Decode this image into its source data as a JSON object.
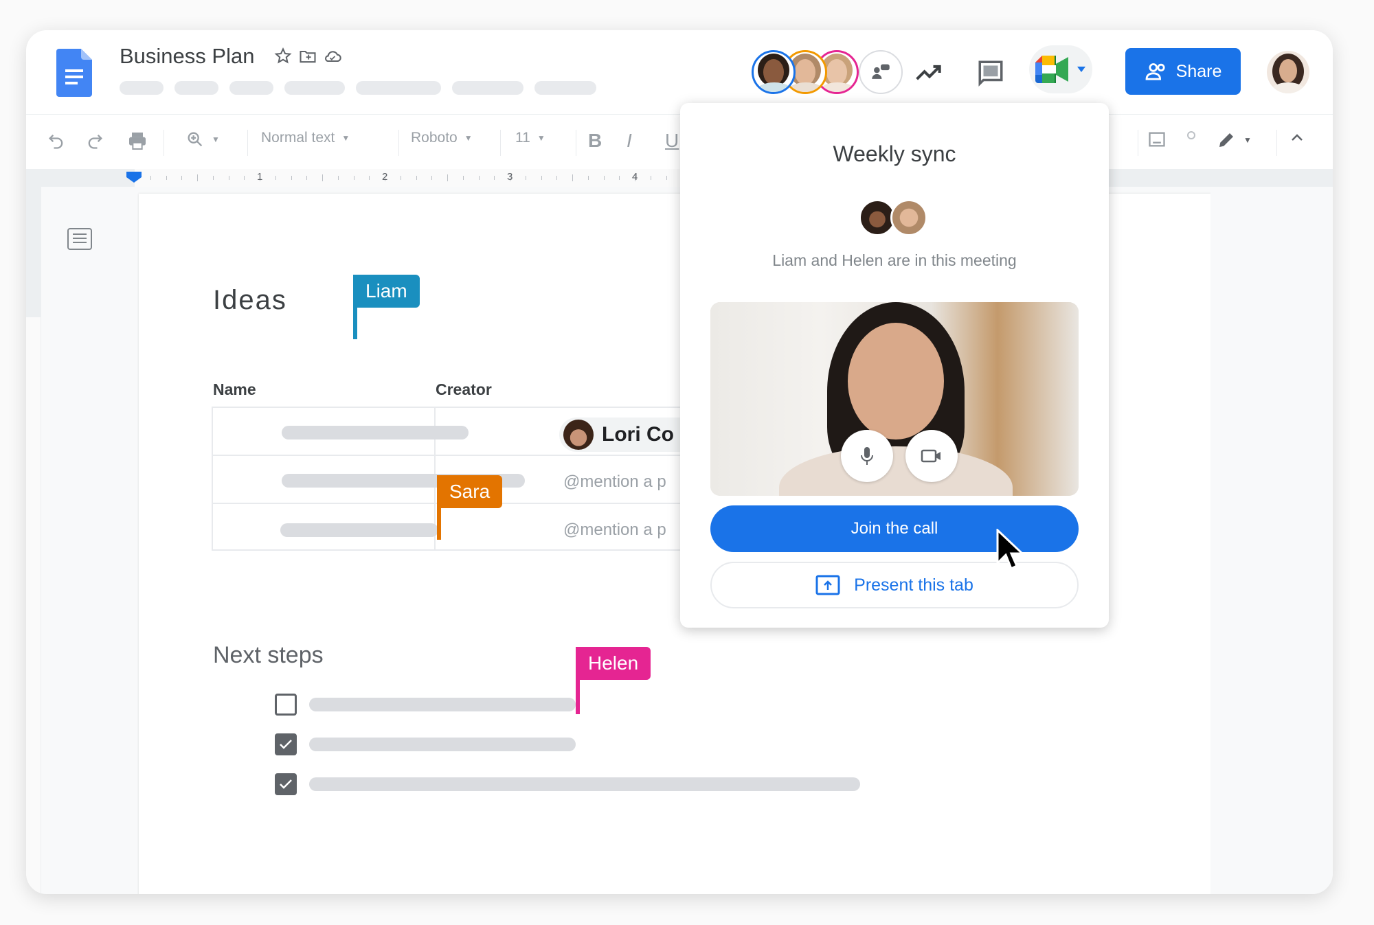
{
  "app": {
    "doc_title": "Business Plan",
    "title_icons": [
      "star-icon",
      "move-to-folder-icon",
      "cloud-saved-icon"
    ],
    "menu_placeholders": 7
  },
  "header": {
    "collaborators": [
      {
        "name": "collaborator-1",
        "ring_color": "#1a73e8"
      },
      {
        "name": "collaborator-2",
        "ring_color": "#f29900"
      },
      {
        "name": "collaborator-3",
        "ring_color": "#e52592"
      }
    ],
    "icons": [
      "people-chat-icon",
      "activity-trend-icon",
      "comments-icon",
      "google-meet-icon"
    ],
    "share_label": "Share",
    "share_color": "#1a73e8"
  },
  "toolbar": {
    "style": "Normal text",
    "font": "Roboto",
    "size": "11",
    "bold": "B",
    "italic": "I",
    "underline": "U"
  },
  "ruler": {
    "numbers": [
      "1",
      "2",
      "3",
      "4"
    ]
  },
  "document": {
    "heading_ideas": "Ideas",
    "table_headers": [
      "Name",
      "Creator"
    ],
    "creator_chip": "Lori Co",
    "mention_placeholder": "@mention a p",
    "heading_next": "Next steps",
    "checklist": [
      {
        "checked": false
      },
      {
        "checked": true
      },
      {
        "checked": true
      }
    ]
  },
  "cursors": [
    {
      "name": "Liam",
      "color": "#1a8fbf"
    },
    {
      "name": "Sara",
      "color": "#e37400"
    },
    {
      "name": "Helen",
      "color": "#e52592"
    }
  ],
  "meet_popup": {
    "title": "Weekly sync",
    "subtitle": "Liam and Helen are in this meeting",
    "join_label": "Join the call",
    "present_label": "Present this tab"
  }
}
